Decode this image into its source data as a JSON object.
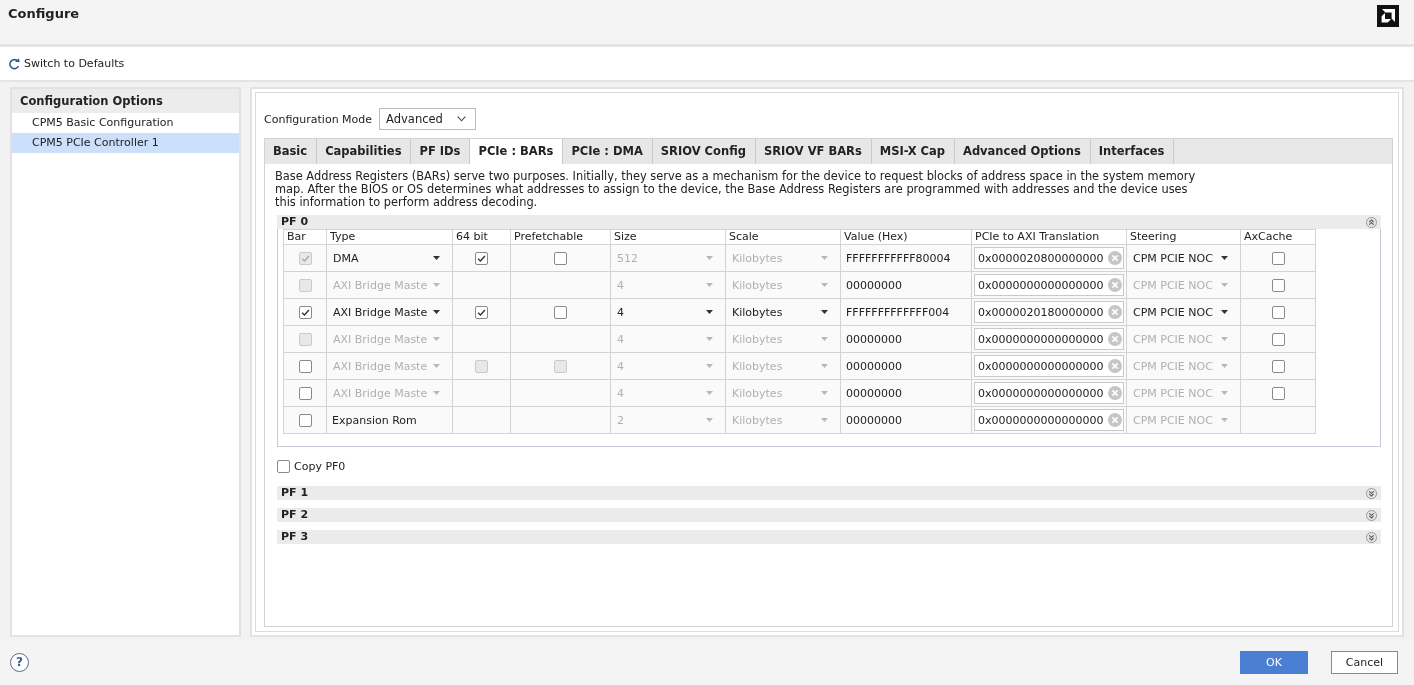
{
  "window": {
    "title": "Configure"
  },
  "toolbar": {
    "reset_label": "Switch to Defaults"
  },
  "sidebar": {
    "title": "Configuration Options",
    "items": [
      {
        "label": "CPM5 Basic Configuration",
        "selected": false
      },
      {
        "label": "CPM5 PCIe Controller 1",
        "selected": true
      }
    ]
  },
  "configuration_mode": {
    "label": "Configuration Mode",
    "value": "Advanced"
  },
  "tabs": [
    {
      "label": "Basic",
      "selected": false
    },
    {
      "label": "Capabilities",
      "selected": false
    },
    {
      "label": "PF IDs",
      "selected": false
    },
    {
      "label": "PCIe : BARs",
      "selected": true
    },
    {
      "label": "PCIe : DMA",
      "selected": false
    },
    {
      "label": "SRIOV Config",
      "selected": false
    },
    {
      "label": "SRIOV VF BARs",
      "selected": false
    },
    {
      "label": "MSI-X Cap",
      "selected": false
    },
    {
      "label": "Advanced Options",
      "selected": false
    },
    {
      "label": "Interfaces",
      "selected": false
    }
  ],
  "description": "Base Address Registers (BARs) serve two purposes. Initially, they serve as a mechanism for the device to request blocks of address space in the system memory map. After the BIOS or OS determines what addresses to assign to the device, the Base Address Registers are programmed with addresses and the device uses this information to perform address decoding.",
  "pf_sections": [
    {
      "title": "PF 0",
      "expanded": true,
      "table": {
        "columns": [
          "Bar",
          "Type",
          "64 bit",
          "Prefetchable",
          "Size",
          "Scale",
          "Value (Hex)",
          "PCIe to AXI Translation",
          "Steering",
          "AxCache"
        ],
        "rows": [
          {
            "bar": {
              "checked": true,
              "disabled": true
            },
            "type": {
              "kind": "dropdown",
              "value": "DMA",
              "disabled": false
            },
            "bit64": {
              "checked": true,
              "disabled": false
            },
            "prefetchable": {
              "checked": false,
              "disabled": false
            },
            "size": {
              "value": "512",
              "disabled": true
            },
            "scale": {
              "value": "Kilobytes",
              "disabled": true
            },
            "value": "FFFFFFFFFFF80004",
            "translation": "0x0000020800000000",
            "steering": {
              "value": "CPM PCIE NOC",
              "disabled": false
            },
            "axcache": {
              "checked": false
            }
          },
          {
            "bar": {
              "checked": false,
              "disabled": true
            },
            "type": {
              "kind": "dropdown",
              "value": "AXI Bridge Maste",
              "disabled": true
            },
            "size": {
              "value": "4",
              "disabled": true
            },
            "scale": {
              "value": "Kilobytes",
              "disabled": true
            },
            "value": "00000000",
            "translation": "0x0000000000000000",
            "steering": {
              "value": "CPM PCIE NOC",
              "disabled": true
            },
            "axcache": {
              "checked": false
            }
          },
          {
            "bar": {
              "checked": true,
              "disabled": false
            },
            "type": {
              "kind": "dropdown",
              "value": "AXI Bridge Maste",
              "disabled": false
            },
            "bit64": {
              "checked": true,
              "disabled": false
            },
            "prefetchable": {
              "checked": false,
              "disabled": false
            },
            "size": {
              "value": "4",
              "disabled": false
            },
            "scale": {
              "value": "Kilobytes",
              "disabled": false
            },
            "value": "FFFFFFFFFFFFF004",
            "translation": "0x0000020180000000",
            "steering": {
              "value": "CPM PCIE NOC",
              "disabled": false
            },
            "axcache": {
              "checked": false
            }
          },
          {
            "bar": {
              "checked": false,
              "disabled": true
            },
            "type": {
              "kind": "dropdown",
              "value": "AXI Bridge Maste",
              "disabled": true
            },
            "size": {
              "value": "4",
              "disabled": true
            },
            "scale": {
              "value": "Kilobytes",
              "disabled": true
            },
            "value": "00000000",
            "translation": "0x0000000000000000",
            "steering": {
              "value": "CPM PCIE NOC",
              "disabled": true
            },
            "axcache": {
              "checked": false
            }
          },
          {
            "bar": {
              "checked": false,
              "disabled": false
            },
            "type": {
              "kind": "dropdown",
              "value": "AXI Bridge Maste",
              "disabled": true
            },
            "bit64": {
              "checked": false,
              "disabled": true
            },
            "prefetchable": {
              "checked": false,
              "disabled": true
            },
            "size": {
              "value": "4",
              "disabled": true
            },
            "scale": {
              "value": "Kilobytes",
              "disabled": true
            },
            "value": "00000000",
            "translation": "0x0000000000000000",
            "steering": {
              "value": "CPM PCIE NOC",
              "disabled": true
            },
            "axcache": {
              "checked": false
            }
          },
          {
            "bar": {
              "checked": false,
              "disabled": false
            },
            "type": {
              "kind": "dropdown",
              "value": "AXI Bridge Maste",
              "disabled": true
            },
            "size": {
              "value": "4",
              "disabled": true
            },
            "scale": {
              "value": "Kilobytes",
              "disabled": true
            },
            "value": "00000000",
            "translation": "0x0000000000000000",
            "steering": {
              "value": "CPM PCIE NOC",
              "disabled": true
            },
            "axcache": {
              "checked": false
            }
          },
          {
            "bar": {
              "checked": false,
              "disabled": false
            },
            "type": {
              "kind": "text",
              "value": "Expansion Rom"
            },
            "size": {
              "value": "2",
              "disabled": true
            },
            "scale": {
              "value": "Kilobytes",
              "disabled": true
            },
            "value": "00000000",
            "translation": "0x0000000000000000",
            "steering": {
              "value": "CPM PCIE NOC",
              "disabled": true
            }
          }
        ]
      },
      "copy_option": {
        "label": "Copy PF0",
        "checked": false
      }
    },
    {
      "title": "PF 1",
      "expanded": false
    },
    {
      "title": "PF 2",
      "expanded": false
    },
    {
      "title": "PF 3",
      "expanded": false
    }
  ],
  "footer": {
    "help": "?",
    "buttons": [
      {
        "label": "OK",
        "kind": "primary"
      },
      {
        "label": "Cancel",
        "kind": "secondary"
      }
    ]
  }
}
